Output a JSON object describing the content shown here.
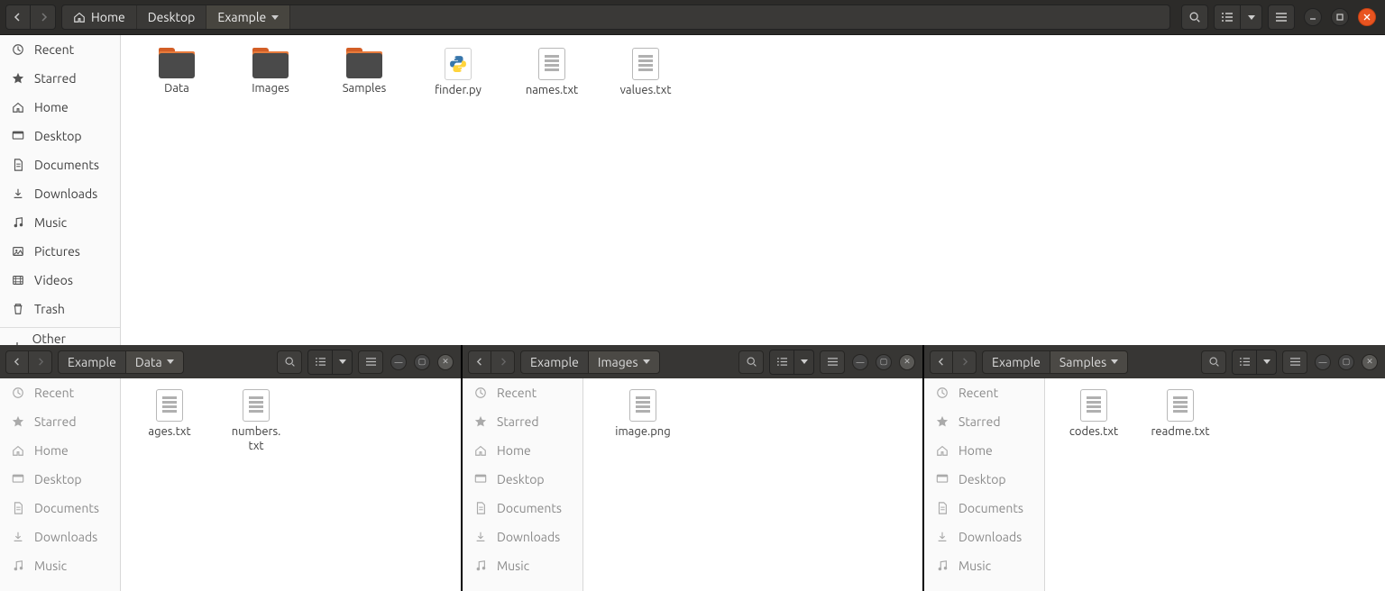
{
  "main": {
    "breadcrumbs": [
      "Home",
      "Desktop",
      "Example"
    ],
    "sidebar": {
      "items": [
        {
          "icon": "clock",
          "label": "Recent"
        },
        {
          "icon": "star",
          "label": "Starred"
        },
        {
          "icon": "home",
          "label": "Home"
        },
        {
          "icon": "desktop",
          "label": "Desktop"
        },
        {
          "icon": "doc",
          "label": "Documents"
        },
        {
          "icon": "download",
          "label": "Downloads"
        },
        {
          "icon": "music",
          "label": "Music"
        },
        {
          "icon": "picture",
          "label": "Pictures"
        },
        {
          "icon": "video",
          "label": "Videos"
        },
        {
          "icon": "trash",
          "label": "Trash"
        }
      ],
      "other": "Other Locations"
    },
    "files": [
      {
        "type": "folder",
        "name": "Data"
      },
      {
        "type": "folder",
        "name": "Images"
      },
      {
        "type": "folder",
        "name": "Samples"
      },
      {
        "type": "py",
        "name": "finder.py"
      },
      {
        "type": "txt",
        "name": "names.txt"
      },
      {
        "type": "txt",
        "name": "values.txt"
      }
    ]
  },
  "small_sidebar": [
    {
      "icon": "clock",
      "label": "Recent"
    },
    {
      "icon": "star",
      "label": "Starred"
    },
    {
      "icon": "home",
      "label": "Home"
    },
    {
      "icon": "desktop",
      "label": "Desktop"
    },
    {
      "icon": "doc",
      "label": "Documents"
    },
    {
      "icon": "download",
      "label": "Downloads"
    },
    {
      "icon": "music",
      "label": "Music"
    }
  ],
  "winA": {
    "breadcrumbs": [
      "Example",
      "Data"
    ],
    "files": [
      {
        "type": "txt",
        "name": "ages.txt"
      },
      {
        "type": "txt",
        "name": "numbers.\ntxt"
      }
    ]
  },
  "winB": {
    "breadcrumbs": [
      "Example",
      "Images"
    ],
    "files": [
      {
        "type": "txt",
        "name": "image.png"
      }
    ]
  },
  "winC": {
    "breadcrumbs": [
      "Example",
      "Samples"
    ],
    "files": [
      {
        "type": "txt",
        "name": "codes.txt"
      },
      {
        "type": "txt",
        "name": "readme.txt"
      }
    ]
  }
}
